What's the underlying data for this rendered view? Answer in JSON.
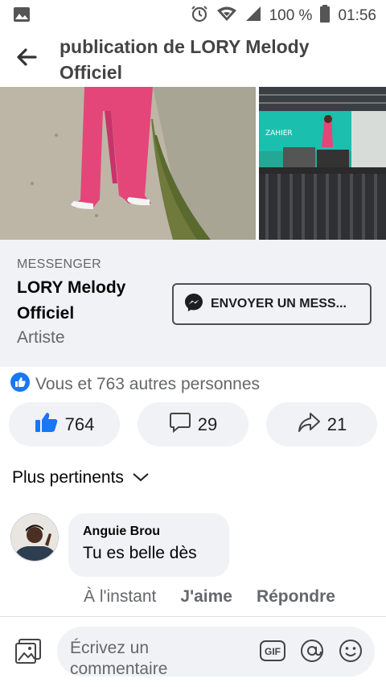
{
  "status_bar": {
    "battery": "100 %",
    "time": "01:56",
    "icons": [
      "image-icon",
      "alarm-icon",
      "wifi-icon",
      "signal-icon",
      "battery-icon"
    ]
  },
  "header": {
    "title": "publication de LORY Melody Officiel"
  },
  "messenger_card": {
    "label": "MESSENGER",
    "page_name": "LORY Melody Officiel",
    "category": "Artiste",
    "button_label": "ENVOYER UN MESS..."
  },
  "reactions": {
    "summary": "Vous et 763 autres personnes",
    "like_count": "764",
    "comment_count": "29",
    "share_count": "21"
  },
  "comments_section": {
    "sort_label": "Plus pertinents",
    "comments": [
      {
        "author": "Anguie Brou",
        "text": "Tu es belle dès",
        "time": "À l'instant",
        "like_label": "J'aime",
        "reply_label": "Répondre"
      }
    ]
  },
  "composer": {
    "placeholder": "Écrivez un commentaire",
    "gif_label": "GIF"
  },
  "colors": {
    "accent": "#1877f2",
    "secondary_text": "#65676b",
    "surface": "#f0f2f5"
  }
}
